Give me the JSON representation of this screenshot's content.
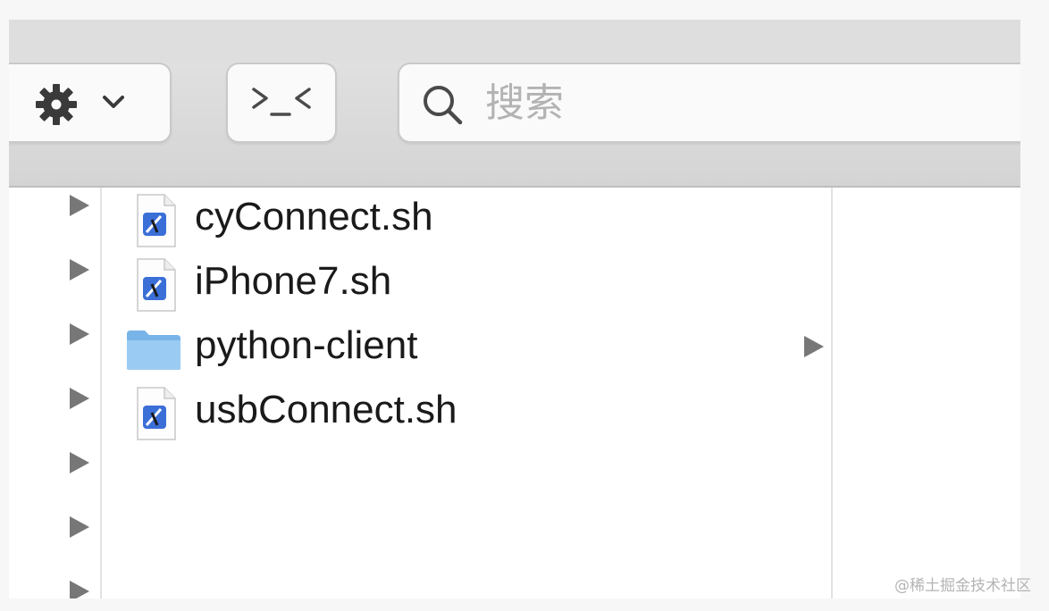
{
  "toolbar": {
    "action_button_icon": "gear-icon",
    "terminal_button_icon": "terminal-icon",
    "search": {
      "placeholder": "搜索",
      "value": ""
    }
  },
  "files": [
    {
      "name": "cyConnect.sh",
      "icon": "shell-script-icon",
      "is_folder": false
    },
    {
      "name": "iPhone7.sh",
      "icon": "shell-script-icon",
      "is_folder": false
    },
    {
      "name": "python-client",
      "icon": "folder-icon",
      "is_folder": true
    },
    {
      "name": "usbConnect.sh",
      "icon": "shell-script-icon",
      "is_folder": false
    }
  ],
  "colors": {
    "folder": "#8ec3ef",
    "script_badge": "#3b6fd8",
    "disclosure": "#777777"
  },
  "watermark": "@稀土掘金技术社区"
}
